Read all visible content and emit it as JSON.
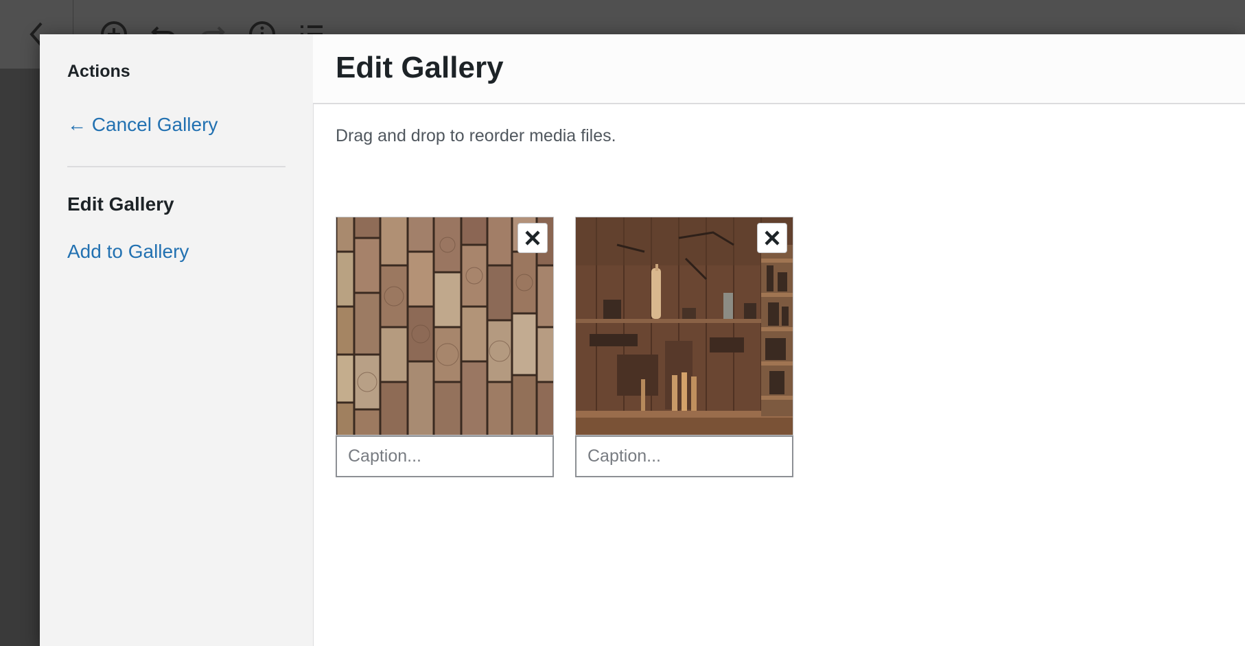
{
  "menu": {
    "heading": "Actions",
    "cancel_label": "← Cancel Gallery",
    "current_label": "Edit Gallery",
    "add_label": "Add to Gallery"
  },
  "frame": {
    "title": "Edit Gallery",
    "instructions": "Drag and drop to reorder media files."
  },
  "attachments": [
    {
      "caption_placeholder": "Caption...",
      "caption_value": ""
    },
    {
      "caption_placeholder": "Caption...",
      "caption_value": ""
    }
  ],
  "colors": {
    "link": "#2271b1",
    "text": "#1d2327",
    "menu_bg": "#f3f3f3",
    "backdrop": "#4a4a4a"
  },
  "icons": [
    "chevron-left-icon",
    "add-block-icon",
    "undo-icon",
    "redo-icon",
    "info-icon",
    "list-view-icon",
    "close-icon"
  ]
}
